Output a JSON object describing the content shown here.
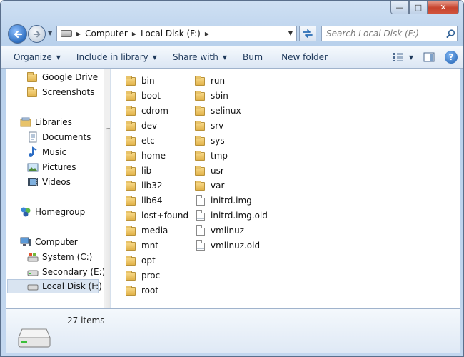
{
  "window": {
    "minimize_glyph": "—",
    "maximize_glyph": "□",
    "close_glyph": "✕"
  },
  "address": {
    "crumbs": [
      "Computer",
      "Local Disk (F:)"
    ],
    "refresh_icon": "refresh-icon"
  },
  "search": {
    "placeholder": "Search Local Disk (F:)"
  },
  "toolbar": {
    "organize": "Organize",
    "include_in_library": "Include in library",
    "share_with": "Share with",
    "burn": "Burn",
    "new_folder": "New folder",
    "help": "?"
  },
  "nav": {
    "favorites": [
      "Google Drive",
      "Screenshots"
    ],
    "libraries": "Libraries",
    "library_items": [
      "Documents",
      "Music",
      "Pictures",
      "Videos"
    ],
    "homegroup": "Homegroup",
    "computer": "Computer",
    "drives": [
      "System (C:)",
      "Secondary (E:)",
      "Local Disk (F:)"
    ],
    "selected": "Local Disk (F:)"
  },
  "files": {
    "column1": [
      "bin",
      "boot",
      "cdrom",
      "dev",
      "etc",
      "home",
      "lib",
      "lib32",
      "lib64",
      "lost+found",
      "media",
      "mnt",
      "opt",
      "proc",
      "root"
    ],
    "column2_folders": [
      "run",
      "sbin",
      "selinux",
      "srv",
      "sys",
      "tmp",
      "usr",
      "var"
    ],
    "column2_files": [
      "initrd.img",
      "initrd.img.old",
      "vmlinuz",
      "vmlinuz.old"
    ]
  },
  "details": {
    "item_count": "27 items"
  },
  "colors": {
    "accent": "#1e395b",
    "selection": "#d9e4f1",
    "folder": "#e8c36a"
  }
}
